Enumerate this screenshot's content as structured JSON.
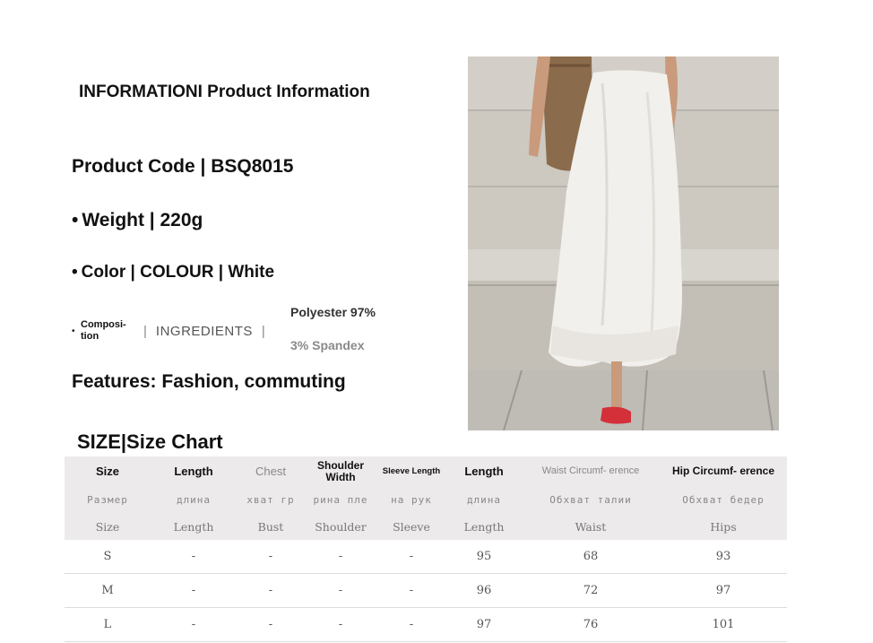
{
  "info": {
    "title": "INFORMATIONI Product Information",
    "product_code": "Product Code | BSQ8015",
    "weight": "Weight | 220g",
    "color": "Color | COLOUR | White",
    "composition_label": "Composi- tion",
    "ingredients_label": "INGREDIENTS",
    "separator": "|",
    "bullet": "•",
    "fabric_1": "Polyester 97%",
    "fabric_2": "3% Spandex",
    "features": "Features: Fashion, commuting"
  },
  "size_chart": {
    "title": "SIZE|Size Chart",
    "headers": [
      "Size",
      "Length",
      "Chest",
      "Shoulder Width",
      "Sleeve Length",
      "Length",
      "Waist Circumf- erence",
      "Hip Circumf- erence"
    ],
    "russian_headers": [
      "Размер",
      "длина",
      "хват гр",
      "рина пле",
      "на рук",
      "длина",
      "Обхват талии",
      "Обхват бедер"
    ],
    "english_headers": [
      "Size",
      "Length",
      "Bust",
      "Shoulder",
      "Sleeve",
      "Length",
      "Waist",
      "Hips"
    ],
    "rows": [
      [
        "S",
        "-",
        "-",
        "-",
        "-",
        "95",
        "68",
        "93"
      ],
      [
        "M",
        "-",
        "-",
        "-",
        "-",
        "96",
        "72",
        "97"
      ],
      [
        "L",
        "-",
        "-",
        "-",
        "-",
        "97",
        "76",
        "101"
      ]
    ]
  },
  "photo": {
    "subject": "model wearing white satin maxi skirt with woven bag",
    "skirt_color": "#f2f0ec",
    "wall_color": "#cfcbc3",
    "shoe_color": "#d4303a"
  }
}
